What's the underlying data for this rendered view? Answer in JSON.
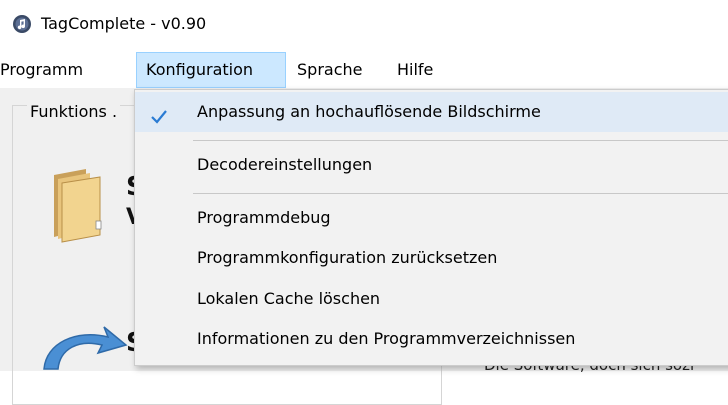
{
  "window": {
    "title": "TagComplete - v0.90"
  },
  "menubar": {
    "items": [
      "Programm",
      "Konfiguration",
      "Sprache",
      "Hilfe"
    ],
    "active_index": 1
  },
  "content": {
    "groupbox_label": "Funktions .",
    "letter_1": "S",
    "letter_2": "V",
    "letter_3": "S",
    "cut_text": "Die Software, doch sich sozi"
  },
  "dropdown": {
    "items": [
      {
        "label": "Anpassung an hochauflösende Bildschirme",
        "checked": true
      },
      {
        "label": "Decodereinstellungen"
      },
      {
        "label": "Programmdebug"
      },
      {
        "label": "Programmkonfiguration zurücksetzen"
      },
      {
        "label": "Lokalen Cache löschen"
      },
      {
        "label": "Informationen zu den Programmverzeichnissen"
      }
    ]
  },
  "colors": {
    "active_menu_bg": "#cce8ff",
    "active_menu_border": "#99d1ff",
    "dropdown_bg": "#f2f2f2",
    "checked_item_bg": "#dfeaf6",
    "checkmark": "#2a7bd3"
  },
  "icons": [
    "app-icon",
    "checkmark-icon",
    "folder-icon",
    "sync-icon"
  ]
}
